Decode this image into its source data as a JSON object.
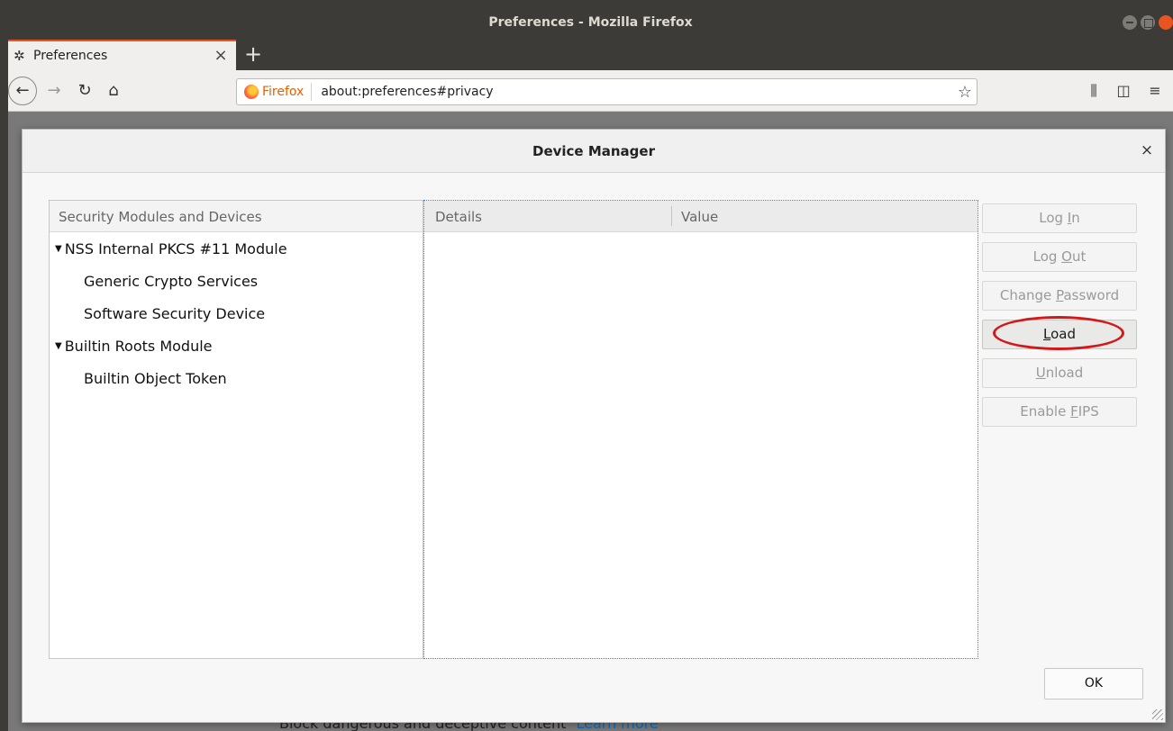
{
  "window": {
    "title": "Preferences - Mozilla Firefox"
  },
  "tab": {
    "label": "Preferences",
    "close": "×",
    "new_tab": "+"
  },
  "nav": {
    "identity_label": "Firefox",
    "url": "about:preferences#privacy",
    "back": "←",
    "forward": "→",
    "reload": "↻",
    "home": "⌂",
    "bookmark_star": "☆",
    "library": "⫼",
    "sidebar": "◫",
    "menu": "≡"
  },
  "page": {
    "peek_text": "Block dangerous and deceptive content",
    "peek_link": "Learn more"
  },
  "dialog": {
    "title": "Device Manager",
    "close": "×",
    "tree": {
      "header": "Security Modules and Devices",
      "items": [
        {
          "label": "NSS Internal PKCS #11 Module",
          "expanded": true,
          "level": 0
        },
        {
          "label": "Generic Crypto Services",
          "level": 1
        },
        {
          "label": "Software Security Device",
          "level": 1
        },
        {
          "label": "Builtin Roots Module",
          "expanded": true,
          "level": 0
        },
        {
          "label": "Builtin Object Token",
          "level": 1
        }
      ]
    },
    "details": {
      "col_details": "Details",
      "col_value": "Value"
    },
    "buttons": {
      "login": {
        "before": "Log ",
        "key": "I",
        "after": "n",
        "enabled": false
      },
      "logout": {
        "before": "Log ",
        "key": "O",
        "after": "ut",
        "enabled": false
      },
      "change_password": {
        "before": "Change ",
        "key": "P",
        "after": "assword",
        "enabled": false
      },
      "load": {
        "before": "",
        "key": "L",
        "after": "oad",
        "enabled": true
      },
      "unload": {
        "before": "",
        "key": "U",
        "after": "nload",
        "enabled": false
      },
      "enable_fips": {
        "before": "Enable ",
        "key": "F",
        "after": "IPS",
        "enabled": false
      }
    },
    "ok": "OK"
  },
  "colors": {
    "accent": "#e95420",
    "highlight_ring": "#d21919"
  }
}
